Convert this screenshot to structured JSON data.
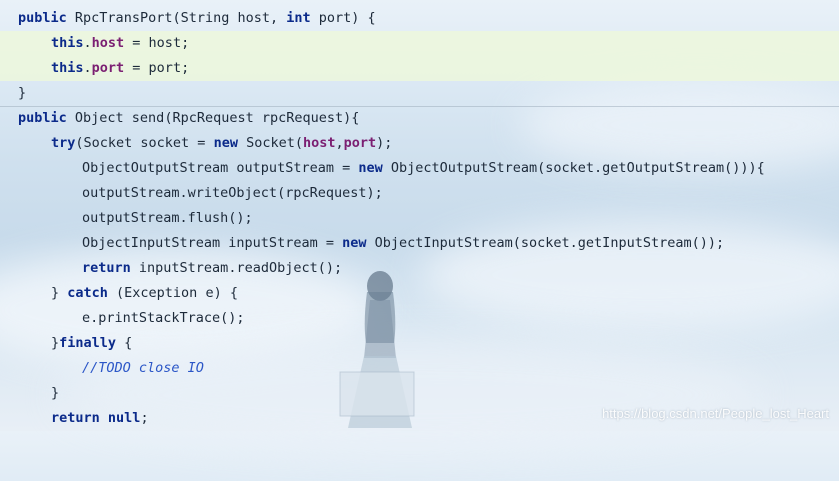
{
  "editor": {
    "lines": [
      "public RpcTransPort(String host, int port) {",
      "this.host = host;",
      "this.port = port;",
      "}",
      "public Object send(RpcRequest rpcRequest){",
      "try(Socket socket = new Socket(host,port);",
      "ObjectOutputStream outputStream = new ObjectOutputStream(socket.getOutputStream())){",
      "outputStream.writeObject(rpcRequest);",
      "outputStream.flush();",
      "ObjectInputStream inputStream = new ObjectInputStream(socket.getInputStream());",
      "return inputStream.readObject();",
      "} catch (Exception e) {",
      "e.printStackTrace();",
      "}finally {",
      "//TODO close IO",
      "}",
      "return null;"
    ]
  },
  "watermark": "https://blog.csdn.net/People_lost_Heart",
  "colors": {
    "keyword": "#0b2a8a",
    "field": "#7b1f72",
    "comment": "#2b56c7",
    "caret_line": "#eef8da"
  }
}
